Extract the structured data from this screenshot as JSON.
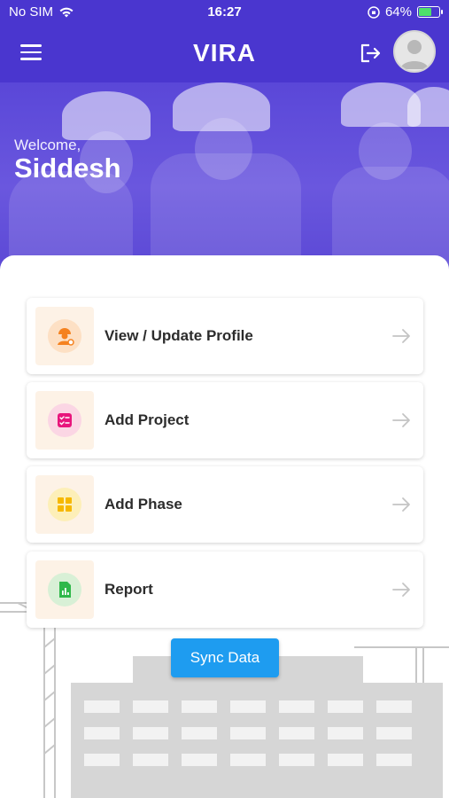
{
  "status_bar": {
    "carrier": "No SIM",
    "time": "16:27",
    "battery": "64%",
    "battery_level": 0.64
  },
  "header": {
    "title": "VIRA"
  },
  "hero": {
    "welcome": "Welcome,",
    "name": "Siddesh"
  },
  "menu": [
    {
      "label": "View / Update Profile",
      "icon": "profile-icon",
      "color": "#f5821f"
    },
    {
      "label": "Add Project",
      "icon": "checklist-icon",
      "color": "#e8157c"
    },
    {
      "label": "Add Phase",
      "icon": "grid-icon",
      "color": "#f6b800"
    },
    {
      "label": "Report",
      "icon": "report-icon",
      "color": "#2fb84a"
    }
  ],
  "sync_button": "Sync Data",
  "colors": {
    "primary": "#4a36cf",
    "accent": "#1e9cf0",
    "tile_bg": "#fdf2e6"
  }
}
